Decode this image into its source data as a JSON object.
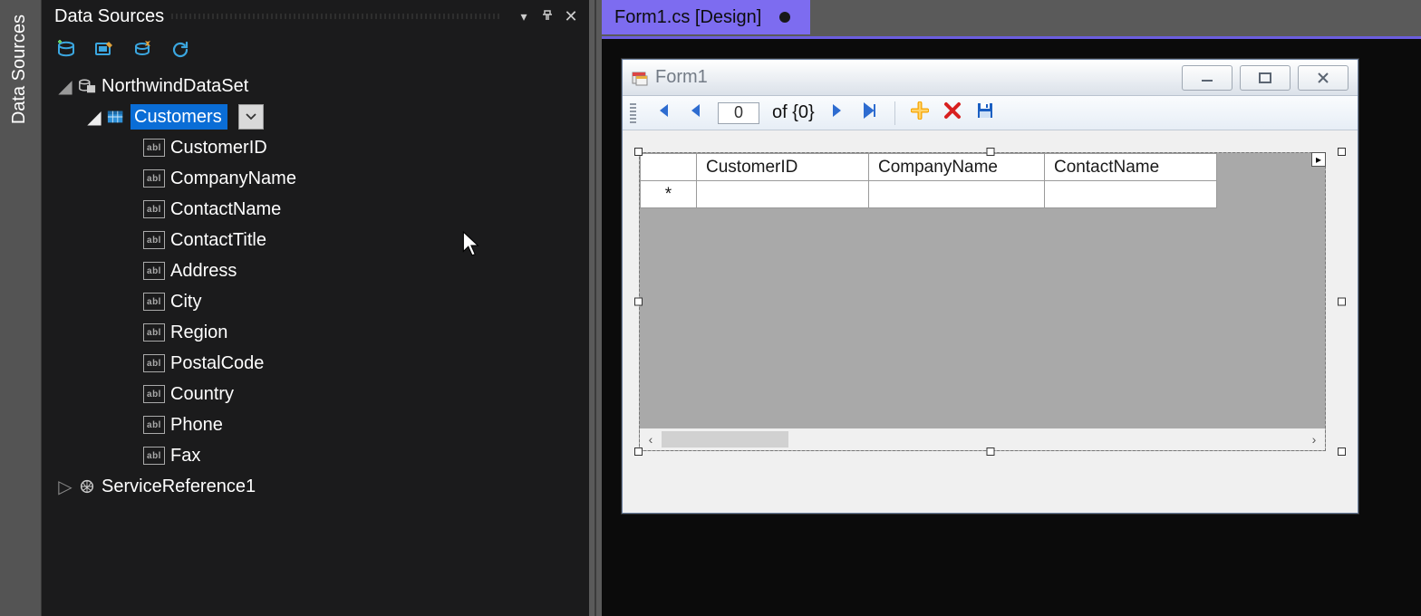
{
  "vtab": {
    "label": "Data Sources"
  },
  "panel": {
    "title": "Data Sources",
    "toolbar": [
      "add-data-source-icon",
      "edit-dataset-icon",
      "config-wizard-icon",
      "refresh-icon"
    ]
  },
  "tree": {
    "root": {
      "label": "NorthwindDataSet"
    },
    "selected": {
      "label": "Customers"
    },
    "fields": [
      "CustomerID",
      "CompanyName",
      "ContactName",
      "ContactTitle",
      "Address",
      "City",
      "Region",
      "PostalCode",
      "Country",
      "Phone",
      "Fax"
    ],
    "sibling": {
      "label": "ServiceReference1"
    }
  },
  "tab": {
    "label": "Form1.cs [Design]"
  },
  "form": {
    "title": "Form1"
  },
  "navigator": {
    "position": "0",
    "of": "of {0}"
  },
  "grid": {
    "columns": [
      "CustomerID",
      "CompanyName",
      "ContactName"
    ],
    "new_row_marker": "*"
  }
}
